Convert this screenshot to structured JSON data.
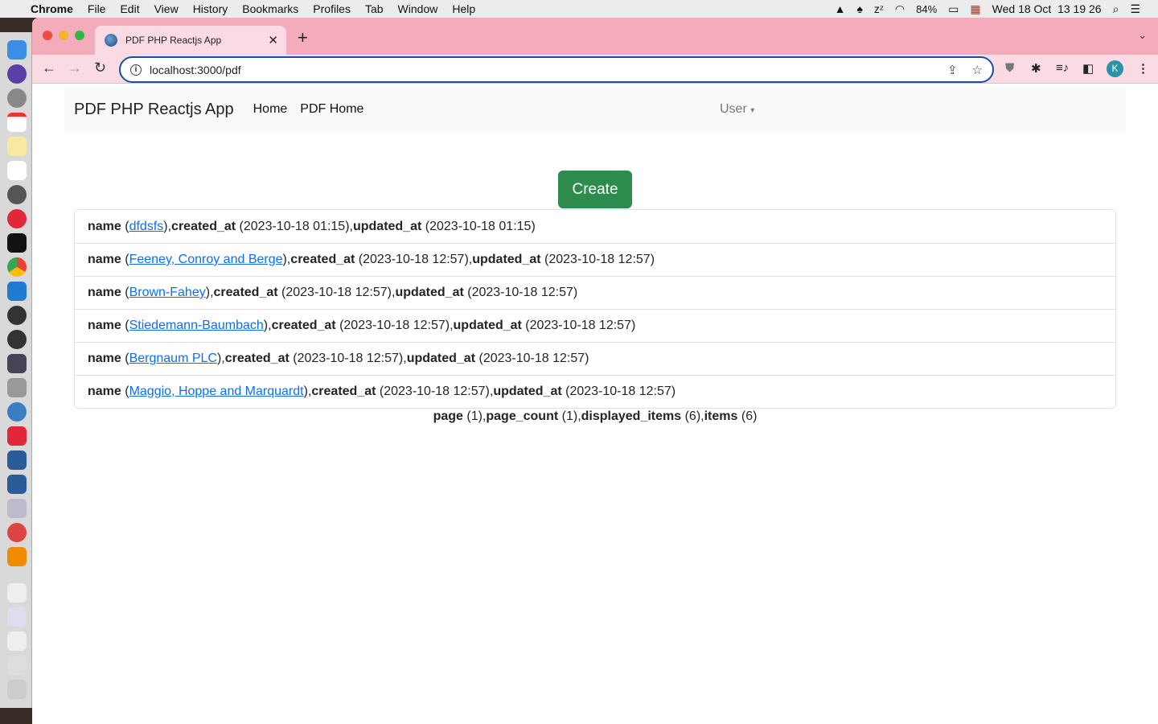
{
  "menubar": {
    "app": "Chrome",
    "items": [
      "File",
      "Edit",
      "View",
      "History",
      "Bookmarks",
      "Profiles",
      "Tab",
      "Window",
      "Help"
    ],
    "battery": "84%",
    "datetime": "Wed 18 Oct  13 19 26"
  },
  "browser": {
    "tab_title": "PDF PHP Reactjs App",
    "url": "localhost:3000/pdf",
    "avatar": "K"
  },
  "navbar": {
    "brand": "PDF PHP Reactjs App",
    "links": [
      "Home",
      "PDF Home"
    ],
    "user": "User"
  },
  "create_label": "Create",
  "labels": {
    "name": "name",
    "created_at": "created_at",
    "updated_at": "updated_at"
  },
  "rows": [
    {
      "name": "dfdsfs",
      "created_at": "2023-10-18 01:15",
      "updated_at": "2023-10-18 01:15"
    },
    {
      "name": "Feeney, Conroy and Berge",
      "created_at": "2023-10-18 12:57",
      "updated_at": "2023-10-18 12:57"
    },
    {
      "name": "Brown-Fahey",
      "created_at": "2023-10-18 12:57",
      "updated_at": "2023-10-18 12:57"
    },
    {
      "name": "Stiedemann-Baumbach",
      "created_at": "2023-10-18 12:57",
      "updated_at": "2023-10-18 12:57"
    },
    {
      "name": "Bergnaum PLC",
      "created_at": "2023-10-18 12:57",
      "updated_at": "2023-10-18 12:57"
    },
    {
      "name": "Maggio, Hoppe and Marquardt",
      "created_at": "2023-10-18 12:57",
      "updated_at": "2023-10-18 12:57"
    }
  ],
  "pagination": {
    "page_label": "page",
    "page": "1",
    "page_count_label": "page_count",
    "page_count": "1",
    "displayed_items_label": "displayed_items",
    "displayed_items": "6",
    "items_label": "items",
    "items": "6"
  }
}
